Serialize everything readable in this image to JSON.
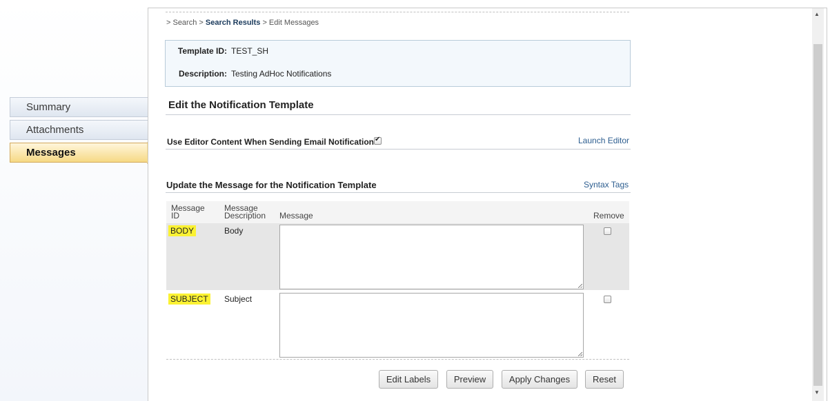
{
  "sidebar": {
    "tabs": [
      {
        "label": "Summary",
        "active": false
      },
      {
        "label": "Attachments",
        "active": false
      },
      {
        "label": "Messages",
        "active": true
      }
    ]
  },
  "breadcrumb": {
    "prefix": "> Search >",
    "current": "Search Results",
    "suffix": "> Edit Messages"
  },
  "template_info": {
    "id_label": "Template ID:",
    "id_value": "TEST_SH",
    "desc_label": "Description:",
    "desc_value": "Testing AdHoc Notifications"
  },
  "edit_section": {
    "title": "Edit the Notification Template",
    "editor_option_label": "Use Editor Content When Sending Email Notification:",
    "editor_option_checked": true,
    "launch_editor_link": "Launch Editor"
  },
  "update_section": {
    "title": "Update the Message for the Notification Template",
    "syntax_tags_link": "Syntax Tags"
  },
  "messages_table": {
    "columns": {
      "message_id": [
        "Message",
        "ID"
      ],
      "message_description": [
        "Message",
        "Description"
      ],
      "message": "Message",
      "remove": "Remove"
    },
    "rows": [
      {
        "id": "BODY",
        "description": "Body",
        "message": "",
        "remove": false
      },
      {
        "id": "SUBJECT",
        "description": "Subject",
        "message": "",
        "remove": false
      }
    ]
  },
  "buttons": {
    "edit_labels": "Edit Labels",
    "preview": "Preview",
    "apply_changes": "Apply Changes",
    "reset": "Reset"
  },
  "scrollbar": {
    "up_arrow": "▲",
    "down_arrow": "▼"
  },
  "colors": {
    "active_tab": "#f6d985",
    "info_box": "#f3f8fc",
    "highlight": "#fbf233",
    "link": "#2c5d8f"
  }
}
